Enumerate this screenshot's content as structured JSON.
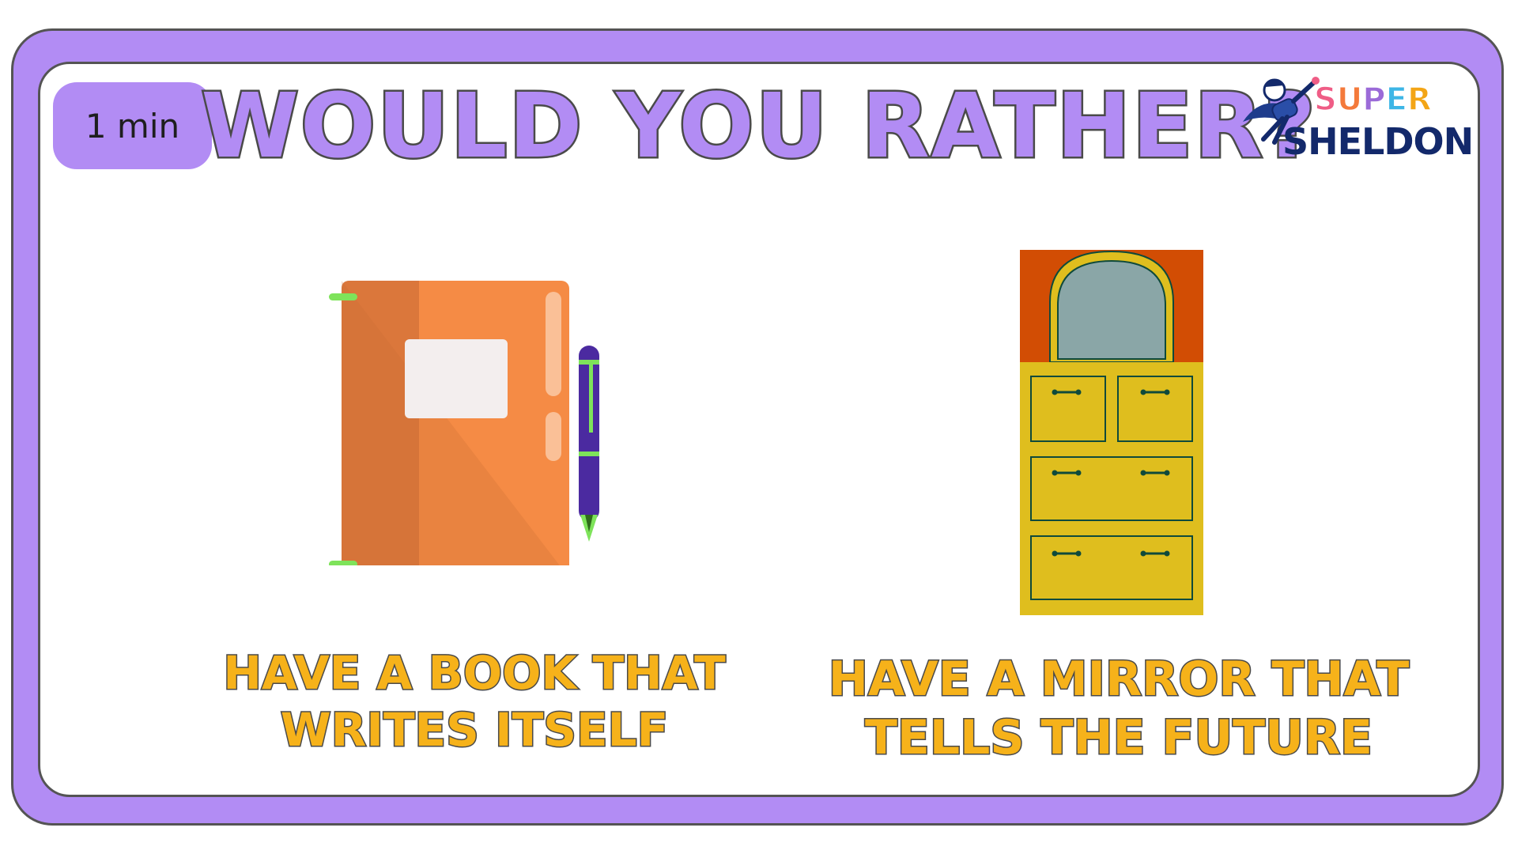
{
  "timer": {
    "label": "1 min"
  },
  "header": {
    "title": "WOULD YOU RATHER?"
  },
  "logo": {
    "word_top_letters": [
      {
        "char": "S",
        "color": "#ef5d86"
      },
      {
        "char": "U",
        "color": "#f47a3b"
      },
      {
        "char": "P",
        "color": "#9b6bd8"
      },
      {
        "char": "E",
        "color": "#3db6e6"
      },
      {
        "char": "R",
        "color": "#f3a516"
      }
    ],
    "word_bottom": "SHELDON"
  },
  "options": [
    {
      "id": "book",
      "icon": "notebook-with-pen-icon",
      "line1": "HAVE A BOOK THAT",
      "line2": "WRITES ITSELF"
    },
    {
      "id": "mirror",
      "icon": "mirror-dresser-icon",
      "line1": "HAVE A MIRROR THAT",
      "line2": "TELLS THE FUTURE"
    }
  ],
  "colors": {
    "frame": "#b28cf4",
    "frame_outline": "#545454",
    "answer_text": "#f6b21a",
    "book_cover": "#f58b45",
    "pen_body": "#4b2aa0",
    "dresser_body": "#dfbe1e",
    "dresser_top": "#d24d04"
  }
}
